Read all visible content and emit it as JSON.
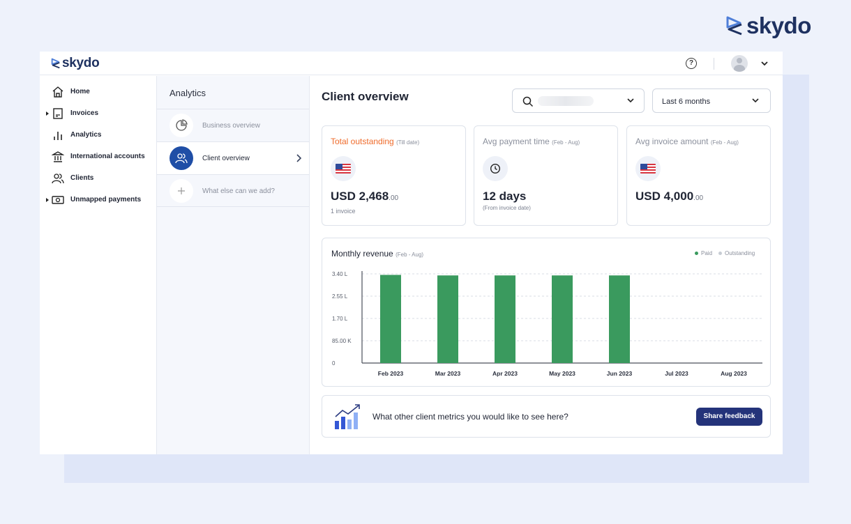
{
  "brand": {
    "name": "skydo"
  },
  "topbar": {
    "help_icon": "question-circle-icon",
    "avatar_icon": "user-avatar-icon",
    "menu_icon": "chevron-down-icon"
  },
  "sidebar": {
    "items": [
      {
        "label": "Home",
        "icon": "home-icon",
        "expandable": false
      },
      {
        "label": "Invoices",
        "icon": "invoice-icon",
        "expandable": true
      },
      {
        "label": "Analytics",
        "icon": "bar-chart-icon",
        "expandable": false
      },
      {
        "label": "International accounts",
        "icon": "bank-icon",
        "expandable": false
      },
      {
        "label": "Clients",
        "icon": "users-icon",
        "expandable": false
      },
      {
        "label": "Unmapped payments",
        "icon": "money-icon",
        "expandable": true
      }
    ]
  },
  "analytics_panel": {
    "title": "Analytics",
    "items": [
      {
        "label": "Business overview",
        "icon": "pie-chart-icon",
        "active": false
      },
      {
        "label": "Client overview",
        "icon": "users-icon",
        "active": true
      },
      {
        "label": "What else can we add?",
        "icon": "plus-icon",
        "active": false
      }
    ]
  },
  "main": {
    "title": "Client overview",
    "client_select": {
      "value": ""
    },
    "period_select": {
      "value": "Last 6 months"
    }
  },
  "cards": [
    {
      "title": "Total outstanding",
      "subtitle": "(Till date)",
      "icon": "us-flag-icon",
      "value": "USD 2,468",
      "decimals": ".00",
      "note": "1 invoice"
    },
    {
      "title": "Avg payment time",
      "subtitle": "(Feb - Aug)",
      "icon": "clock-icon",
      "value": "12 days",
      "decimals": "",
      "note": "(From invoice date)"
    },
    {
      "title": "Avg invoice amount",
      "subtitle": "(Feb - Aug)",
      "icon": "us-flag-icon",
      "value": "USD 4,000",
      "decimals": ".00",
      "note": ""
    }
  ],
  "chart_data": {
    "type": "bar",
    "title": "Monthly revenue",
    "subtitle": "(Feb - Aug)",
    "categories": [
      "Feb 2023",
      "Mar 2023",
      "Apr 2023",
      "May 2023",
      "Jun 2023",
      "Jul 2023",
      "Aug 2023"
    ],
    "series": [
      {
        "name": "Paid",
        "values": [
          336000,
          334000,
          334000,
          334000,
          334000,
          0,
          0
        ],
        "color": "#3a9a5e"
      },
      {
        "name": "Outstanding",
        "values": [
          0,
          0,
          0,
          0,
          0,
          0,
          0
        ],
        "color": "#c7ccd4"
      }
    ],
    "yticks": [
      0,
      85000,
      170000,
      255000,
      340000
    ],
    "ytick_labels": [
      "0",
      "85.00 K",
      "1.70 L",
      "2.55 L",
      "3.40 L"
    ],
    "ylim": [
      0,
      340000
    ],
    "grid": true,
    "legend": "top-right"
  },
  "feedback": {
    "icon": "growth-chart-icon",
    "text": "What other client metrics you would like to see here?",
    "button_label": "Share feedback"
  }
}
